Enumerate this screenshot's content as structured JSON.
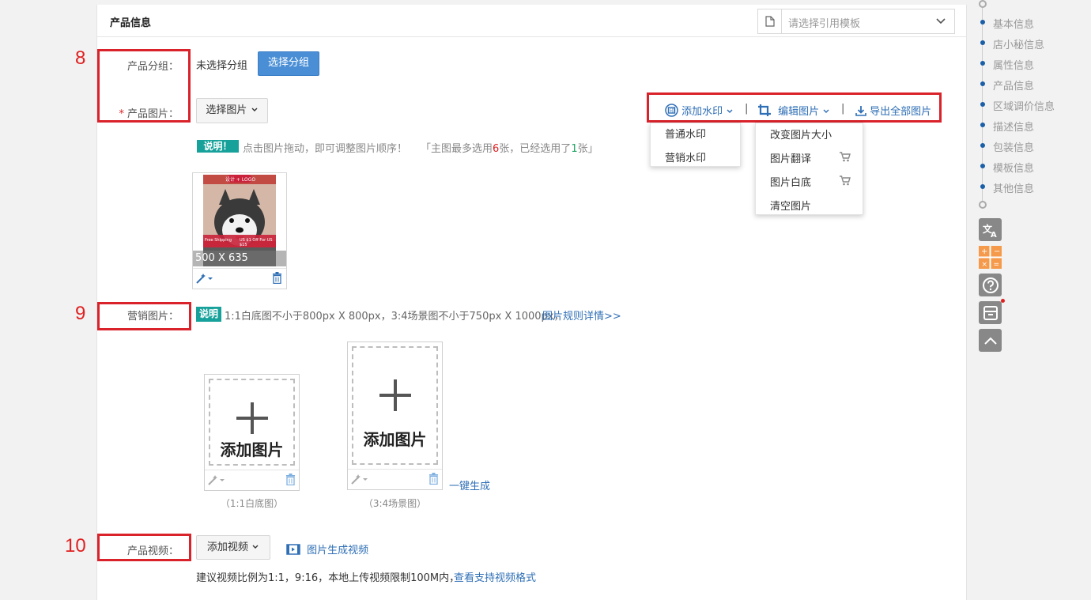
{
  "panel": {
    "title": "产品信息",
    "template_placeholder": "请选择引用模板"
  },
  "annotations": [
    "8",
    "9",
    "10"
  ],
  "group": {
    "label": "产品分组：",
    "status": "未选择分组",
    "button": "选择分组"
  },
  "product_images": {
    "required_mark": "*",
    "label": "产品图片：",
    "select_button": "选择图片",
    "badge": "说明！",
    "hint_text": "点击图片拖动，即可调整图片顺序！",
    "limit_prefix": "「主图最多选用",
    "limit_max": "6",
    "limit_mid": "张，已经选用了",
    "limit_used": "1",
    "limit_suffix": "张」",
    "image": {
      "dimensions": "500 X 635",
      "banner_text": "设计 + LOGO",
      "overlay_left": "Free Shipping",
      "overlay_right": "US $1 Off For US $15"
    }
  },
  "toolbar": {
    "watermark": "添加水印",
    "edit": "编辑图片",
    "export": "导出全部图片",
    "separator": "|"
  },
  "watermark_menu": [
    "普通水印",
    "营销水印"
  ],
  "edit_menu": [
    "改变图片大小",
    "图片翻译",
    "图片白底",
    "清空图片"
  ],
  "marketing": {
    "label": "营销图片：",
    "badge": "说明",
    "hint": "1:1白底图不小于800px X 800px，3:4场景图不小于750px X 1000px，",
    "rules_link": "图片规则详情>>",
    "add_label": "添加图片",
    "caption_square": "（1:1白底图）",
    "caption_scene": "（3:4场景图）",
    "generate_link": "一键生成"
  },
  "video": {
    "label": "产品视频：",
    "add_button": "添加视频",
    "generate_link": "图片生成视频",
    "note": "建议视频比例为1:1，9:16，本地上传视频限制100M内，",
    "formats_link": "查看支持视频格式"
  },
  "nav": [
    "基本信息",
    "店小秘信息",
    "属性信息",
    "产品信息",
    "区域调价信息",
    "描述信息",
    "包装信息",
    "模板信息",
    "其他信息"
  ],
  "colors": {
    "accent": "#4a8fd6",
    "link": "#2f6fb6",
    "annotation": "#d9222a",
    "teal_badge": "#17a19b"
  }
}
